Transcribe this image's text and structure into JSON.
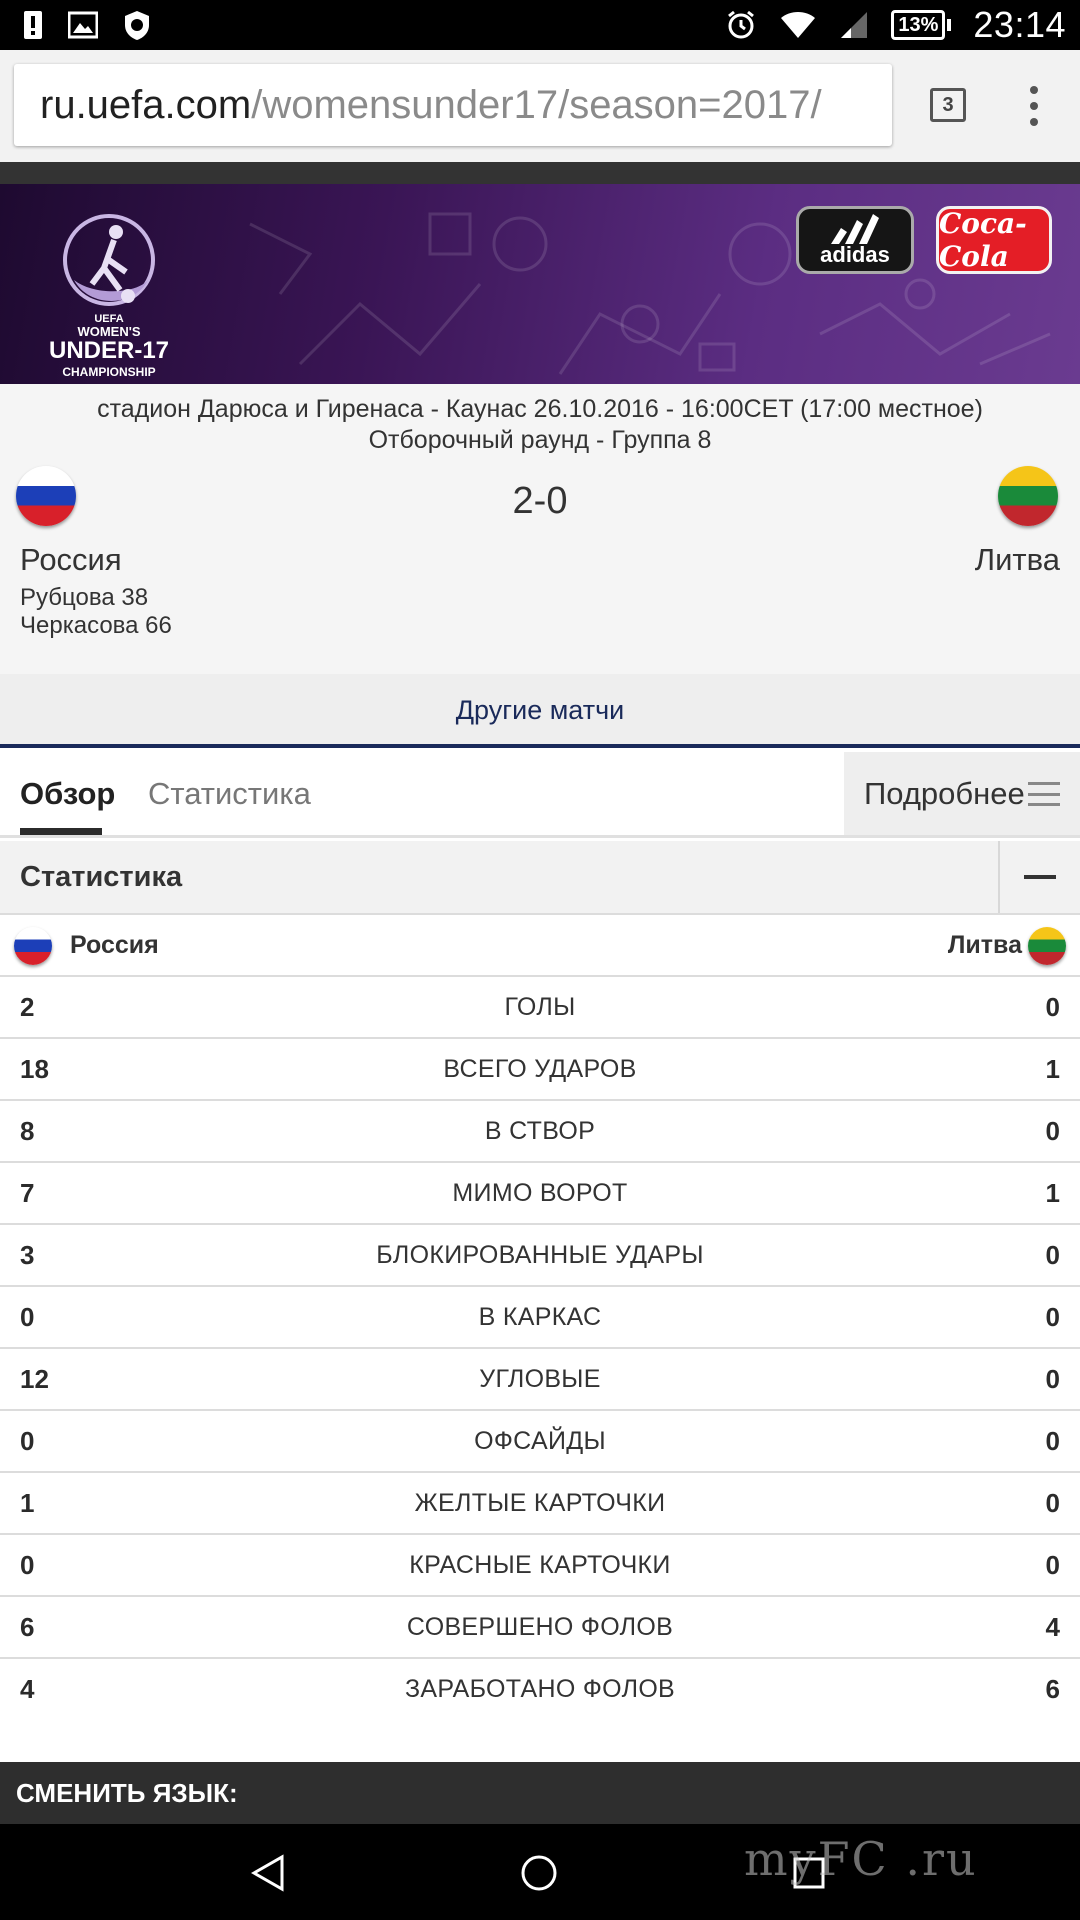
{
  "status_bar": {
    "time": "23:14",
    "battery": "13%",
    "icons": [
      "alert-icon",
      "image-icon",
      "shield-icon",
      "alarm-icon",
      "wifi-icon",
      "signal-icon",
      "battery-icon"
    ]
  },
  "browser": {
    "url_domain": "ru.uefa.com",
    "url_path": "/womensunder17/season=2017/",
    "tab_count": "3"
  },
  "banner": {
    "logo_lines": [
      "UEFA",
      "WOMEN'S",
      "UNDER-17",
      "CHAMPIONSHIP"
    ],
    "sponsors": [
      "adidas",
      "Coca-Cola"
    ],
    "background_color": "#3a1555"
  },
  "match": {
    "venue_line": "стадион Дарюса и Гиренаса - Каунас 26.10.2016 - 16:00CET (17:00 местное)",
    "round_line": "Отборочный раунд - Группа 8",
    "score": "2-0",
    "home_team": "Россия",
    "away_team": "Литва",
    "scorers": [
      "Рубцова 38",
      "Черкасова 66"
    ]
  },
  "other_matches_label": "Другие матчи",
  "tabs": {
    "overview": "Обзор",
    "statistics": "Статистика",
    "more": "Подробнее"
  },
  "stats": {
    "title": "Статистика",
    "home_team": "Россия",
    "away_team": "Литва",
    "rows": [
      {
        "home": "2",
        "label": "ГОЛЫ",
        "away": "0"
      },
      {
        "home": "18",
        "label": "ВСЕГО УДАРОВ",
        "away": "1"
      },
      {
        "home": "8",
        "label": "В СТВОР",
        "away": "0"
      },
      {
        "home": "7",
        "label": "МИМО ВОРОТ",
        "away": "1"
      },
      {
        "home": "3",
        "label": "БЛОКИРОВАННЫЕ УДАРЫ",
        "away": "0"
      },
      {
        "home": "0",
        "label": "В КАРКАС",
        "away": "0"
      },
      {
        "home": "12",
        "label": "УГЛОВЫЕ",
        "away": "0"
      },
      {
        "home": "0",
        "label": "ОФСАЙДЫ",
        "away": "0"
      },
      {
        "home": "1",
        "label": "ЖЕЛТЫЕ КАРТОЧКИ",
        "away": "0"
      },
      {
        "home": "0",
        "label": "КРАСНЫЕ КАРТОЧКИ",
        "away": "0"
      },
      {
        "home": "6",
        "label": "СОВЕРШЕНО ФОЛОВ",
        "away": "4"
      },
      {
        "home": "4",
        "label": "ЗАРАБОТАНО ФОЛОВ",
        "away": "6"
      }
    ]
  },
  "footer": {
    "language_label": "СМЕНИТЬ ЯЗЫК:"
  },
  "watermark": "myFC .ru",
  "colors": {
    "nav_accent": "#1a2a5a",
    "banner_purple": "#5b2d82"
  }
}
